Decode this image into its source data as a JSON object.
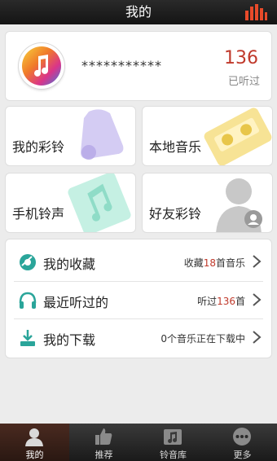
{
  "header": {
    "title": "我的"
  },
  "profile": {
    "username": "***********",
    "listen_count": "136",
    "listen_label": "已听过"
  },
  "tiles": [
    {
      "label": "我的彩铃",
      "icon": "bell-icon",
      "color": "#b9a9e8"
    },
    {
      "label": "本地音乐",
      "icon": "cassette-icon",
      "color": "#f4d86a"
    },
    {
      "label": "手机铃声",
      "icon": "music-note-icon",
      "color": "#8fdcc7"
    },
    {
      "label": "好友彩铃",
      "icon": "friend-icon",
      "color": "#bdbdbd"
    }
  ],
  "list": [
    {
      "label": "我的收藏",
      "icon": "disc-icon",
      "info_prefix": "收藏",
      "info_num": "18",
      "info_suffix": "首音乐"
    },
    {
      "label": "最近听过的",
      "icon": "headphones-icon",
      "info_prefix": "听过",
      "info_num": "136",
      "info_suffix": "首"
    },
    {
      "label": "我的下载",
      "icon": "download-icon",
      "info_prefix": "0个音乐正在下载中",
      "info_num": "",
      "info_suffix": ""
    }
  ],
  "tabbar": [
    {
      "label": "我的",
      "icon": "user-icon",
      "active": true
    },
    {
      "label": "推荐",
      "icon": "thumbs-up-icon",
      "active": false
    },
    {
      "label": "铃音库",
      "icon": "music-folder-icon",
      "active": false
    },
    {
      "label": "更多",
      "icon": "more-icon",
      "active": false
    }
  ],
  "colors": {
    "accent": "#c0392b",
    "teal": "#2aa59a"
  }
}
